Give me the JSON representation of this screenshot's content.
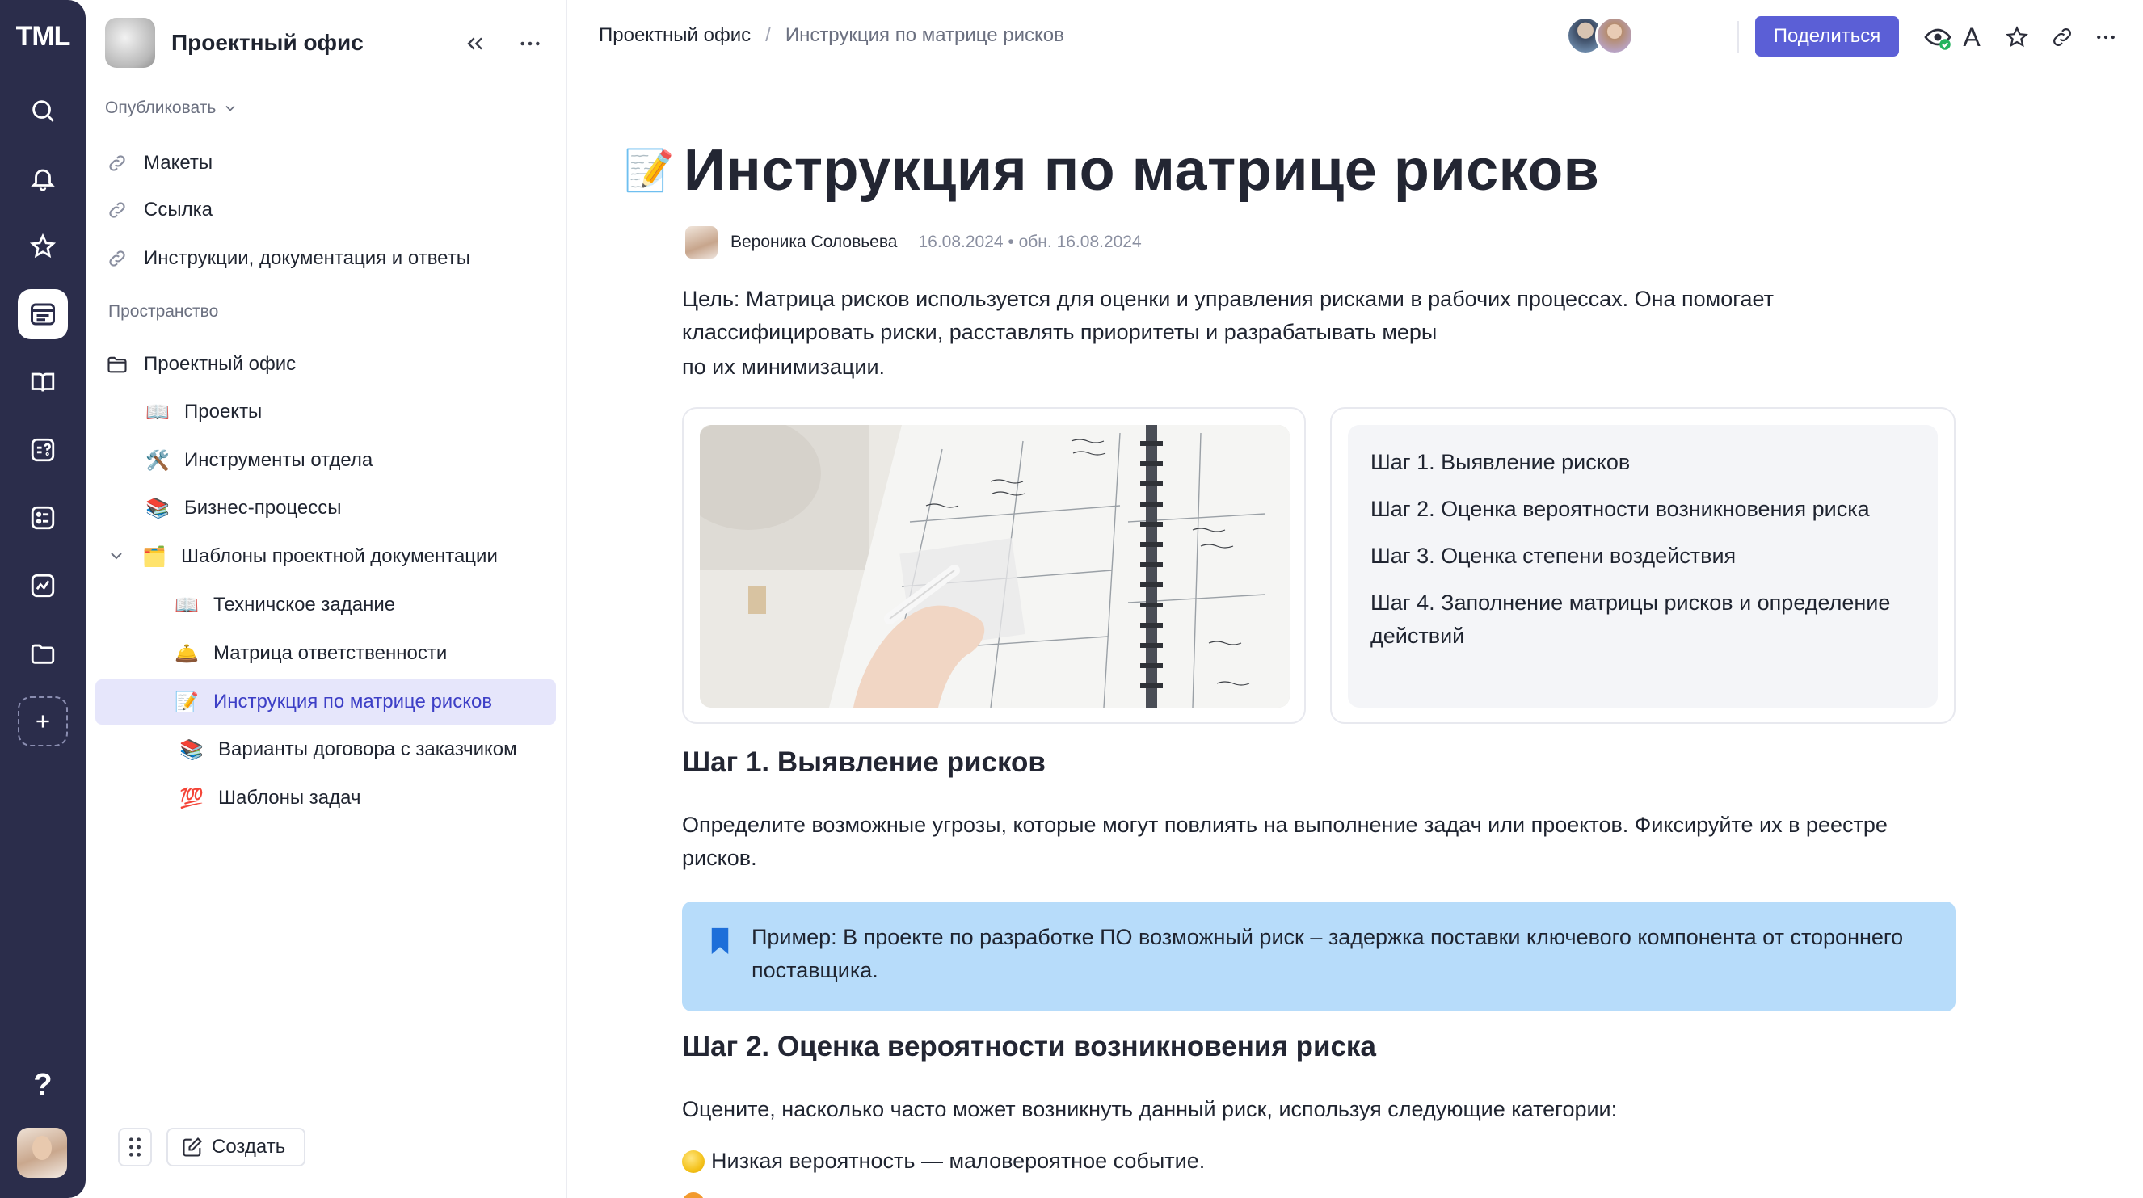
{
  "rail": {
    "logo": "TML",
    "help": "?"
  },
  "sidebar": {
    "space_title": "Проектный офис",
    "publish_label": "Опубликовать",
    "published_items": [
      {
        "label": "Макеты",
        "icon": "link-icon"
      },
      {
        "label": "Ссылка",
        "icon": "link-icon"
      },
      {
        "label": "Инструкции, документация и ответы",
        "icon": "link-icon"
      }
    ],
    "section_label": "Пространство",
    "tree": {
      "root": {
        "label": "Проектный офис",
        "icon": "folder-icon"
      },
      "children": [
        {
          "label": "Проекты",
          "emoji": "📖"
        },
        {
          "label": "Инструменты отдела",
          "emoji": "🛠️"
        },
        {
          "label": "Бизнес-процессы",
          "emoji": "📚"
        },
        {
          "label": "Шаблоны проектной документации",
          "emoji": "🗂️"
        }
      ],
      "templates": [
        {
          "label": "Техничское задание",
          "emoji": "📖"
        },
        {
          "label": "Матрица ответственности",
          "emoji": "🛎️"
        },
        {
          "label": "Инструкция по матрице рисков",
          "emoji": "📝"
        },
        {
          "label": "Варианты договора с заказчиком",
          "emoji": "📚"
        },
        {
          "label": "Шаблоны задач",
          "emoji": "💯"
        }
      ]
    },
    "create_label": "Создать"
  },
  "topbar": {
    "breadcrumb": [
      "Проектный офис",
      "/",
      "Инструкция по матрице рисков"
    ],
    "share_label": "Поделиться",
    "font_icon_label": "A"
  },
  "doc": {
    "emoji": "📝",
    "title": "Инструкция по матрице рисков",
    "author": "Вероника Соловьева",
    "date": "16.08.2024 • обн. 16.08.2024",
    "intro_lines": [
      "Цель: Матрица рисков используется для оценки и управления рисками в рабочих процессах. Она помогает",
      "классифицировать риски, расставлять приоритеты и разрабатывать меры",
      "по их минимизации."
    ],
    "steps": [
      "Шаг 1. Выявление рисков",
      "Шаг 2. Оценка вероятности возникновения риска",
      "Шаг 3. Оценка степени воздействия",
      "Шаг 4. Заполнение матрицы рисков и определение действий"
    ],
    "h_step1": "Шаг 1. Выявление рисков",
    "step1_text": "Определите возможные угрозы, которые могут повлиять на выполнение задач или проектов. Фиксируйте их в реестре рисков.",
    "callout": "Пример: В проекте по разработке ПО возможный риск – задержка поставки ключевого компонента от стороннего поставщика.",
    "h_step2": "Шаг 2. Оценка вероятности возникновения риска",
    "step2_text": "Оцените, насколько часто может возникнуть данный риск, используя следующие категории:",
    "likelihood_low": "Низкая вероятность — маловероятное событие."
  },
  "colors": {
    "rail_bg": "#2b2d4b",
    "accent": "#5b5fd6",
    "selected_bg": "#e6e6fb",
    "callout_bg": "#b7dcfa"
  }
}
